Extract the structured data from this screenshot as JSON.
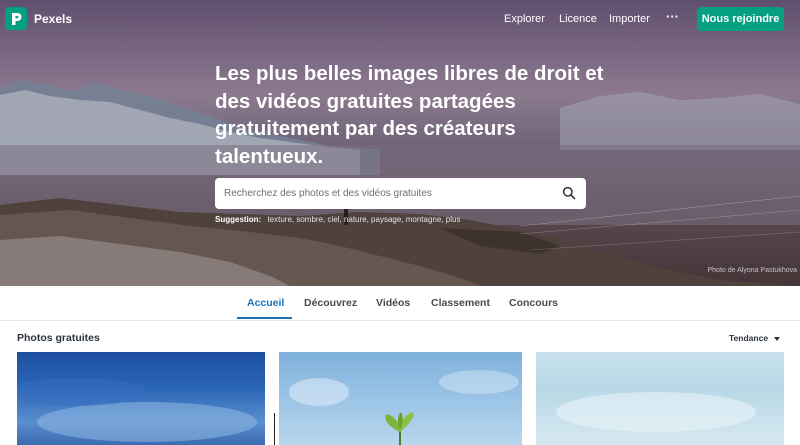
{
  "nav": {
    "brand": "Pexels",
    "links": [
      "Explorer",
      "Licence",
      "Importer"
    ],
    "more": "···",
    "join": "Nous rejoindre"
  },
  "hero": {
    "headline": "Les plus belles images libres de droit et des vidéos gratuites partagées gratuitement par des créateurs talentueux.",
    "search_placeholder": "Recherchez des photos et des vidéos gratuites",
    "suggestion_label": "Suggestion:",
    "suggestions": "texture, sombre, ciel, nature, paysage, montagne, plus",
    "credit": "Photo de Alyona Pastukhova"
  },
  "tabs": [
    "Accueil",
    "Découvrez",
    "Vidéos",
    "Classement",
    "Concours"
  ],
  "active_tab": "Accueil",
  "section": {
    "title": "Photos gratuites",
    "sort": "Tendance"
  },
  "colors": {
    "accent": "#05a081",
    "active_tab": "#1a73b8"
  },
  "icons": {
    "logo": "pexels-logo-icon",
    "search": "search-icon",
    "more": "more-dots-icon",
    "sort": "caret-down-icon"
  }
}
